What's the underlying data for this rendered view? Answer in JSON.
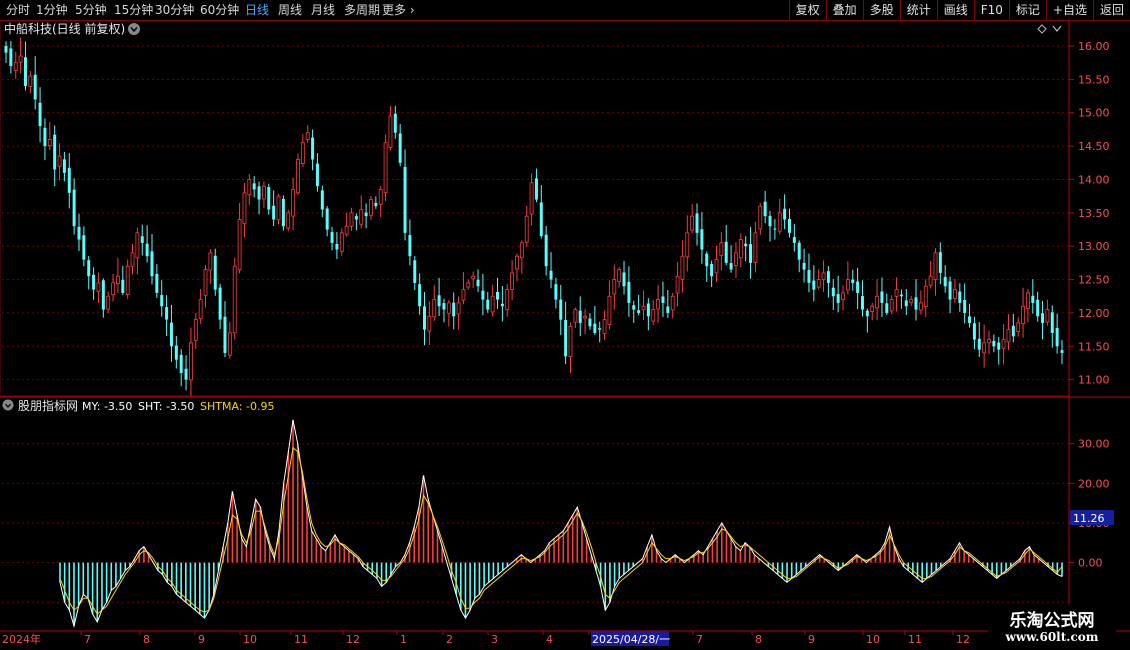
{
  "toolbar": {
    "period_tabs": [
      "分时",
      "1分钟",
      "5分钟",
      "15分钟",
      "30分钟",
      "60分钟",
      "日线",
      "周线",
      "月线",
      "多周期",
      "更多"
    ],
    "active_tab": "日线",
    "right_buttons": [
      "复权",
      "叠加",
      "多股",
      "统计",
      "画线",
      "F10",
      "标记",
      "+自选",
      "返回"
    ]
  },
  "main_chart": {
    "title": "中船科技(日线 前复权)",
    "y_ticks": [
      "16.00",
      "15.50",
      "15.00",
      "14.50",
      "14.00",
      "13.50",
      "13.00",
      "12.50",
      "12.00",
      "11.50",
      "11.00"
    ]
  },
  "indicator": {
    "name": "股朋指标网",
    "values": [
      {
        "label": "MY: -3.50",
        "color": "#ffffff"
      },
      {
        "label": "SHT: -3.50",
        "color": "#ffffff"
      },
      {
        "label": "SHTMA: -0.95",
        "color": "#ffd400"
      }
    ],
    "y_ticks": [
      "30.00",
      "20.00",
      "10.00",
      "0.00"
    ],
    "cursor_value": "11.26"
  },
  "x_axis": {
    "labels": [
      "2024年",
      "7",
      "8",
      "9",
      "10",
      "11",
      "12",
      "1",
      "2",
      "3",
      "4",
      "2025/04/28/一",
      "7",
      "8",
      "9",
      "10",
      "11",
      "12"
    ]
  },
  "watermark": {
    "line1": "乐淘公式网",
    "line2": "www.60lt.com"
  },
  "colors": {
    "up": "#ff3b3b",
    "down": "#54ffff",
    "grid": "#7a0000",
    "accent": "#4aa8ff",
    "axis_label": "#ff4d4d",
    "ma": "#ffd400"
  },
  "chart_data": [
    {
      "type": "candlestick",
      "title": "中船科技(日线 前复权)",
      "ylim": [
        10.8,
        16.3
      ],
      "close": [
        15.9,
        15.7,
        15.75,
        15.85,
        15.4,
        15.55,
        15.2,
        14.8,
        14.5,
        14.6,
        14.15,
        14.35,
        14.1,
        13.8,
        13.3,
        13.1,
        12.8,
        12.55,
        12.35,
        12.45,
        12.05,
        12.25,
        12.45,
        12.55,
        12.3,
        12.7,
        12.9,
        13.2,
        13.05,
        12.85,
        12.55,
        12.3,
        12.1,
        11.9,
        11.5,
        11.3,
        11.1,
        11.0,
        11.55,
        11.9,
        12.2,
        12.65,
        12.9,
        12.35,
        11.9,
        11.4,
        11.7,
        12.7,
        13.4,
        13.8,
        14.0,
        13.85,
        13.7,
        13.9,
        13.55,
        13.4,
        13.75,
        13.3,
        13.5,
        13.85,
        14.3,
        14.55,
        14.7,
        14.3,
        13.9,
        13.55,
        13.25,
        13.05,
        12.95,
        13.2,
        13.3,
        13.5,
        13.4,
        13.55,
        13.45,
        13.7,
        13.6,
        13.85,
        14.55,
        14.95,
        14.7,
        14.25,
        13.2,
        12.85,
        12.45,
        12.1,
        11.75,
        11.95,
        12.2,
        12.1,
        12.05,
        12.15,
        11.95,
        12.15,
        12.35,
        12.45,
        12.55,
        12.4,
        12.2,
        12.05,
        12.25,
        12.2,
        12.1,
        12.35,
        12.6,
        12.85,
        13.05,
        13.45,
        13.95,
        13.7,
        13.15,
        12.7,
        12.5,
        12.2,
        11.9,
        11.35,
        11.8,
        12.05,
        11.85,
        11.95,
        11.8,
        11.7,
        11.75,
        11.9,
        12.25,
        12.5,
        12.65,
        12.4,
        12.15,
        12.05,
        12.0,
        12.1,
        11.95,
        12.05,
        12.2,
        12.15,
        12.0,
        12.25,
        12.55,
        12.85,
        13.2,
        13.45,
        13.2,
        12.95,
        12.7,
        12.55,
        12.8,
        13.05,
        12.75,
        12.65,
        12.9,
        13.1,
        13.0,
        12.75,
        13.2,
        13.6,
        13.45,
        13.3,
        13.25,
        13.5,
        13.4,
        13.2,
        13.05,
        12.8,
        12.65,
        12.45,
        12.35,
        12.5,
        12.6,
        12.45,
        12.25,
        12.15,
        12.3,
        12.5,
        12.45,
        12.3,
        12.05,
        11.95,
        12.1,
        12.25,
        12.15,
        12.0,
        12.2,
        12.35,
        12.25,
        12.1,
        12.2,
        12.05,
        12.15,
        12.4,
        12.55,
        12.9,
        12.6,
        12.4,
        12.2,
        12.35,
        12.15,
        12.0,
        11.85,
        11.6,
        11.45,
        11.55,
        11.6,
        11.5,
        11.45,
        11.6,
        11.75,
        11.65,
        11.85,
        12.1,
        12.3,
        12.15,
        11.95,
        11.85,
        12.05,
        11.7,
        11.5,
        11.4
      ]
    },
    {
      "type": "bar_line",
      "name": "股朋指标网",
      "ylim": [
        -16,
        38
      ],
      "series": [
        {
          "name": "MY",
          "values": [
            -5,
            -10,
            -12,
            -16,
            -11,
            -8,
            -9,
            -13,
            -15,
            -12,
            -10,
            -7,
            -6,
            -4,
            -2,
            -1,
            1,
            3,
            4,
            2,
            0,
            -2,
            -3,
            -5,
            -6,
            -8,
            -9,
            -10,
            -11,
            -12,
            -13,
            -14,
            -12,
            -8,
            -2,
            4,
            10,
            18,
            12,
            6,
            4,
            10,
            16,
            14,
            8,
            4,
            1,
            8,
            20,
            28,
            36,
            30,
            22,
            14,
            8,
            6,
            4,
            3,
            5,
            7,
            5,
            4,
            3,
            2,
            1,
            -1,
            -2,
            -3,
            -4,
            -6,
            -5,
            -3,
            -1,
            0,
            2,
            5,
            9,
            14,
            22,
            16,
            12,
            8,
            4,
            0,
            -4,
            -8,
            -12,
            -14,
            -12,
            -9,
            -8,
            -6,
            -5,
            -4,
            -3,
            -2,
            -1,
            0,
            1,
            2,
            1,
            0,
            1,
            2,
            3,
            5,
            6,
            7,
            8,
            10,
            12,
            14,
            10,
            6,
            2,
            -2,
            -6,
            -12,
            -10,
            -6,
            -4,
            -3,
            -2,
            -1,
            0,
            1,
            4,
            7,
            3,
            1,
            0,
            1,
            2,
            1,
            0,
            1,
            2,
            3,
            2,
            4,
            6,
            8,
            10,
            8,
            6,
            4,
            3,
            5,
            4,
            2,
            1,
            0,
            -1,
            -2,
            -3,
            -4,
            -5,
            -4,
            -3,
            -2,
            -1,
            0,
            1,
            2,
            1,
            0,
            -1,
            -2,
            -1,
            0,
            1,
            2,
            1,
            0,
            1,
            2,
            3,
            5,
            9,
            4,
            1,
            -1,
            -2,
            -3,
            -4,
            -5,
            -4,
            -3,
            -2,
            -1,
            0,
            1,
            3,
            5,
            3,
            2,
            1,
            0,
            -1,
            -2,
            -3,
            -4,
            -3,
            -2,
            -1,
            0,
            1,
            3,
            4,
            2,
            1,
            0,
            -1,
            -2,
            -3,
            -3.5
          ]
        },
        {
          "name": "SHTMA",
          "values": [
            -4,
            -7,
            -10,
            -12,
            -11,
            -9,
            -9,
            -11,
            -13,
            -12,
            -11,
            -9,
            -7,
            -5,
            -3,
            -1.5,
            0,
            2,
            3,
            2.5,
            1,
            -1,
            -2,
            -4,
            -5,
            -7,
            -8,
            -9,
            -10,
            -11,
            -12,
            -12.5,
            -12,
            -9,
            -4,
            1,
            6,
            12,
            11,
            7,
            5,
            8,
            13,
            13,
            9,
            5,
            2,
            6,
            15,
            22,
            29,
            28,
            23,
            16,
            10,
            7,
            5,
            4,
            4.5,
            6,
            5,
            4.5,
            3.5,
            2.5,
            1.5,
            0,
            -1,
            -2,
            -3,
            -4.5,
            -4.5,
            -3.5,
            -2,
            -0.5,
            1,
            3.5,
            7,
            11,
            17,
            15,
            12,
            9,
            5.5,
            2,
            -2,
            -5,
            -9,
            -11.5,
            -11.5,
            -10,
            -9,
            -7,
            -6,
            -5,
            -4,
            -3,
            -2,
            -1,
            0,
            1,
            1,
            0.5,
            1,
            1.5,
            2.5,
            4,
            5,
            6,
            7,
            8.5,
            10.5,
            12.5,
            10.5,
            7.5,
            4,
            0,
            -3.5,
            -8,
            -9,
            -7,
            -5,
            -4,
            -3,
            -2,
            -1,
            0,
            2.5,
            5,
            3.5,
            2,
            1,
            1,
            1.5,
            1,
            0.5,
            1,
            1.5,
            2.5,
            2.5,
            3.5,
            5,
            6.5,
            8.5,
            8,
            6.5,
            5,
            4,
            4.5,
            4,
            3,
            2,
            1,
            0,
            -1,
            -2,
            -3,
            -4,
            -4,
            -3.5,
            -2.5,
            -1.5,
            -0.5,
            0.5,
            1.5,
            1,
            0.5,
            -0.5,
            -1.5,
            -1,
            -0.5,
            0.5,
            1.5,
            1,
            0.5,
            1,
            1.5,
            2.5,
            4,
            7,
            4.5,
            2,
            0,
            -1,
            -2,
            -3,
            -4,
            -4,
            -3.5,
            -2.5,
            -1.5,
            -0.5,
            0.5,
            2,
            4,
            3,
            2.5,
            1.5,
            0.5,
            -0.5,
            -1.5,
            -2.5,
            -3.5,
            -3,
            -2.5,
            -1.5,
            -0.5,
            0.5,
            2,
            3.5,
            2.5,
            1.5,
            0.5,
            -0.5,
            -1.5,
            -2.5,
            -0.95
          ]
        }
      ]
    }
  ]
}
